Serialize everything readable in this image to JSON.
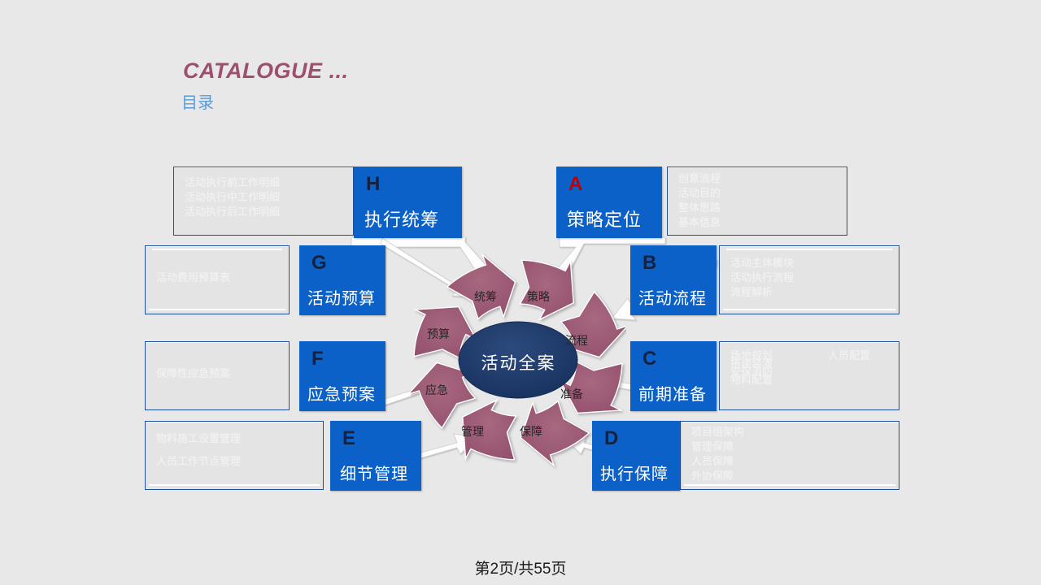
{
  "title": {
    "english": "CATALOGUE ...",
    "chinese": "目录",
    "color_en": "#9c4f6e",
    "color_cn": "#5b9bd5"
  },
  "theme": {
    "background": "#e8e8e8",
    "box_blue": "#0b61c8",
    "box_border": "#1f4e9c",
    "wheel_purple": "#9e5a78",
    "wheel_center": "#1f3864",
    "letter_dark": "#14223f",
    "letter_red": "#c00000"
  },
  "sections": [
    {
      "key": "H",
      "letter": "H",
      "letter_color": "dark",
      "label": "执行统筹",
      "side": "left",
      "details": [
        "活动执行前工作明细",
        "活动执行中工作明细",
        "活动执行后工作明细"
      ]
    },
    {
      "key": "A",
      "letter": "A",
      "letter_color": "red",
      "label": "策略定位",
      "side": "right",
      "details": [
        "创意流程",
        "活动目的",
        "整体思路",
        "基本信息"
      ]
    },
    {
      "key": "G",
      "letter": "G",
      "letter_color": "dark",
      "label": "活动预算",
      "side": "left",
      "details": [
        "活动费用预算表"
      ]
    },
    {
      "key": "B",
      "letter": "B",
      "letter_color": "dark",
      "label": "活动流程",
      "side": "right",
      "details": [
        "活动主体模块",
        "活动执行流程",
        "流程解析"
      ]
    },
    {
      "key": "F",
      "letter": "F",
      "letter_color": "dark",
      "label": "应急预案",
      "side": "left",
      "details": [
        "保障性应急预案"
      ]
    },
    {
      "key": "C",
      "letter": "C",
      "letter_color": "dark",
      "label": "前期准备",
      "side": "right",
      "details": [
        "场地规划",
        "搭建装潢",
        "安保消防",
        "物料配置"
      ],
      "details_extra": [
        "人员配置"
      ]
    },
    {
      "key": "E",
      "letter": "E",
      "letter_color": "dark",
      "label": "细节管理",
      "side": "left",
      "details": [
        "物料施工设置管理",
        "人员工作节点管理"
      ]
    },
    {
      "key": "D",
      "letter": "D",
      "letter_color": "dark",
      "label": "执行保障",
      "side": "right",
      "details": [
        "项目组架构",
        "管理保障",
        "人员保障",
        "外协保障"
      ]
    }
  ],
  "wheel": {
    "center_label": "活动全案",
    "segments": [
      {
        "label": "统筹"
      },
      {
        "label": "策略"
      },
      {
        "label": "流程"
      },
      {
        "label": "准备"
      },
      {
        "label": "保障"
      },
      {
        "label": "管理"
      },
      {
        "label": "应急"
      },
      {
        "label": "预算"
      }
    ]
  },
  "footer": {
    "page_text": "第2页/共55页"
  }
}
